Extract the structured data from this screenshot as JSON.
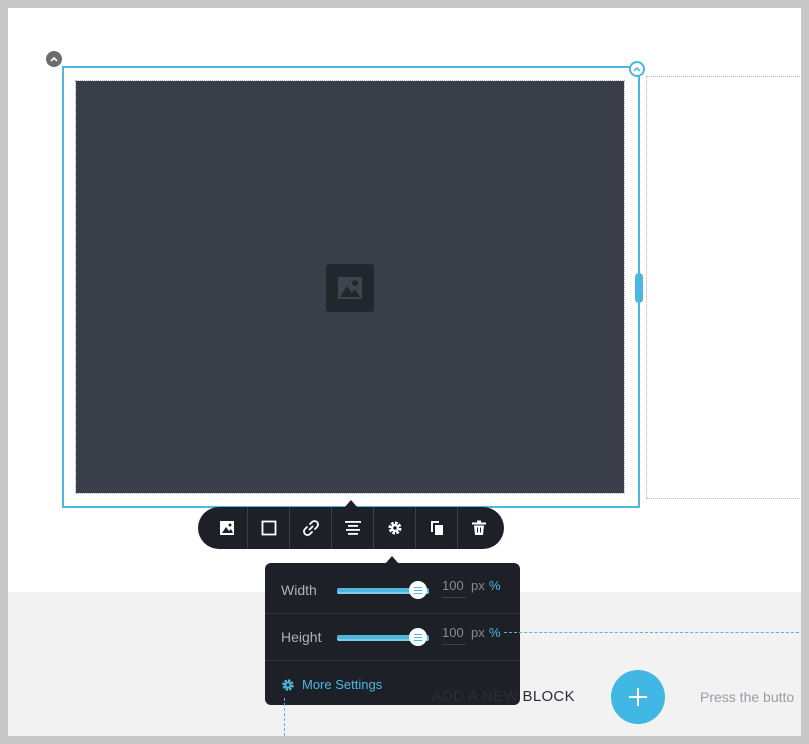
{
  "accent_color": "#4cb8de",
  "image_block": {
    "placeholder_icon": "image-placeholder-icon"
  },
  "toolbar": {
    "buttons": [
      {
        "name": "change-image-button",
        "icon": "image-icon"
      },
      {
        "name": "border-button",
        "icon": "square-icon"
      },
      {
        "name": "link-button",
        "icon": "link-icon"
      },
      {
        "name": "align-button",
        "icon": "align-center-icon"
      },
      {
        "name": "settings-button",
        "icon": "gear-icon"
      },
      {
        "name": "duplicate-button",
        "icon": "copy-icon"
      },
      {
        "name": "delete-button",
        "icon": "trash-icon"
      }
    ]
  },
  "size_popup": {
    "width": {
      "label": "Width",
      "value": "100",
      "unit_px": "px",
      "unit_pct": "%"
    },
    "height": {
      "label": "Height",
      "value": "100",
      "unit_px": "px",
      "unit_pct": "%"
    },
    "more_settings": "More Settings"
  },
  "add_block": {
    "label": "ADD A NEW BLOCK",
    "hint": "Press the butto"
  }
}
